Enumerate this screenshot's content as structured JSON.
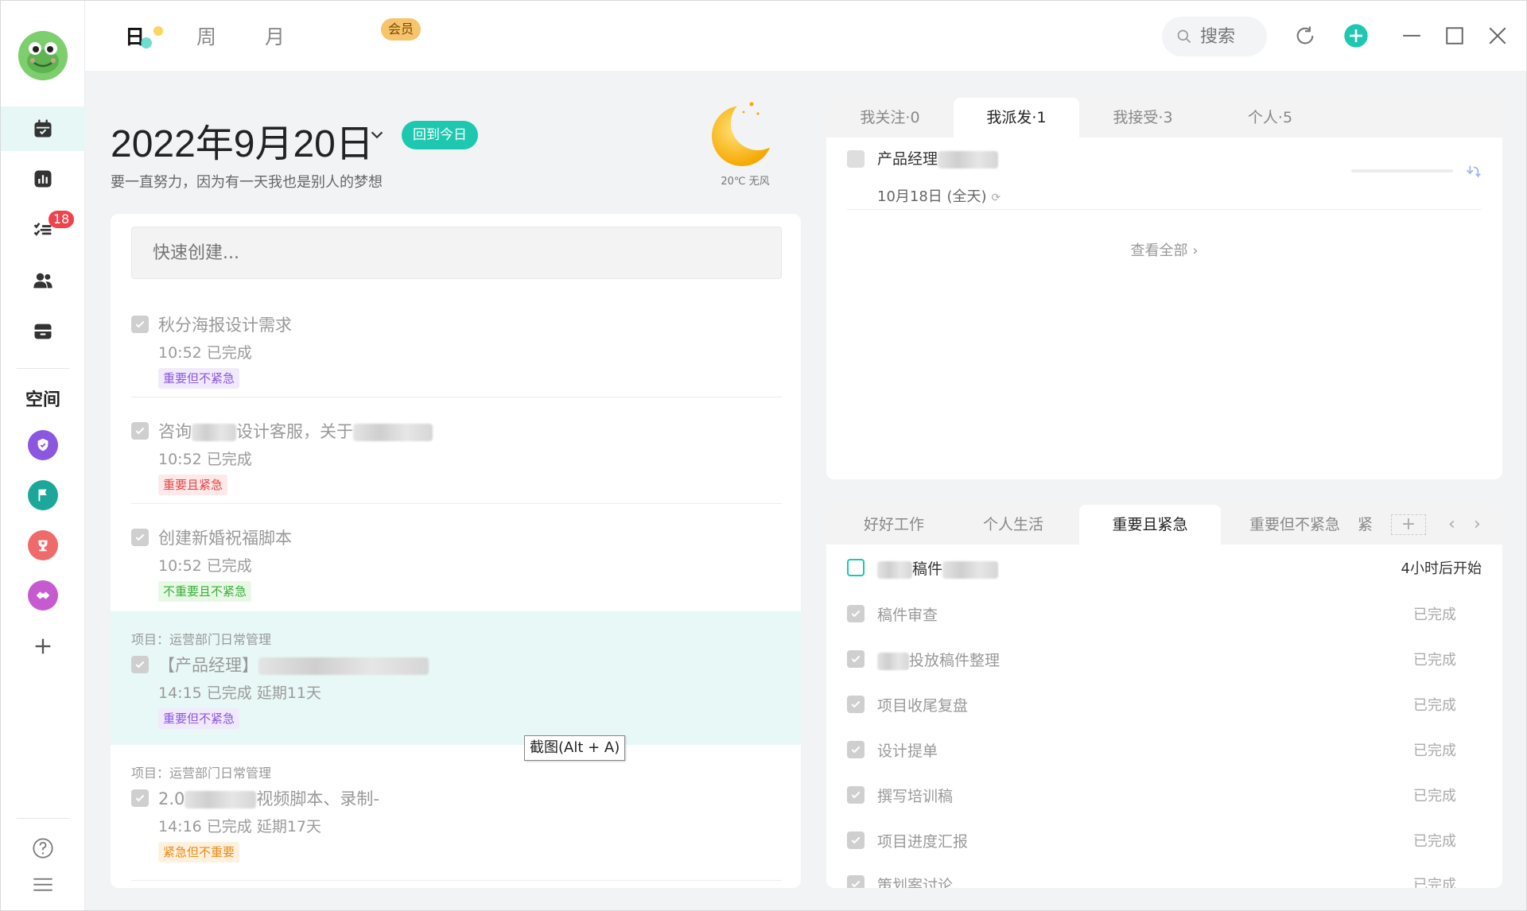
{
  "sidebar": {
    "badge_count": "18",
    "space_label": "空间"
  },
  "topbar": {
    "tabs": [
      {
        "label": "日",
        "active": true
      },
      {
        "label": "周"
      },
      {
        "label": "月"
      }
    ],
    "vip_label": "会员",
    "search_placeholder": "搜索"
  },
  "header": {
    "date": "2022年9月20日",
    "today_button": "回到今日",
    "motto": "要一直努力，因为有一天我也是别人的梦想",
    "weather": "20℃ 无风"
  },
  "tasks": {
    "quick_create_placeholder": "快速创建...",
    "items": [
      {
        "project": "",
        "title": "秋分海报设计需求",
        "meta": "10:52 已完成",
        "tag": "重要但不紧急",
        "tag_color": "purple"
      },
      {
        "project": "",
        "title_a": "咨询",
        "title_b": "设计客服，关于",
        "meta": "10:52 已完成",
        "tag": "重要且紧急",
        "tag_color": "red"
      },
      {
        "project": "",
        "title": "创建新婚祝福脚本",
        "meta": "10:52 已完成",
        "tag": "不重要且不紧急",
        "tag_color": "green"
      },
      {
        "project": "项目：运营部门日常管理",
        "title": "【产品经理】",
        "meta": "14:15 已完成 延期11天",
        "tag": "重要但不紧急",
        "tag_color": "purple"
      },
      {
        "project": "项目：运营部门日常管理",
        "title_a": "2.0",
        "title_b": "视频脚本、录制-",
        "meta": "14:16 已完成 延期17天",
        "tag": "紧急但不重要",
        "tag_color": "orange"
      }
    ],
    "tooltip": "截图(Alt + A)"
  },
  "top_right": {
    "tabs": [
      {
        "label": "我关注·0"
      },
      {
        "label": "我派发·1",
        "active": true
      },
      {
        "label": "我接受·3"
      },
      {
        "label": "个人·5"
      }
    ],
    "item_title": "产品经理",
    "item_date": "10月18日 (全天)",
    "view_all": "查看全部"
  },
  "bottom_right": {
    "tabs": [
      {
        "label": "好好工作"
      },
      {
        "label": "个人生活"
      },
      {
        "label": "重要且紧急",
        "active": true
      },
      {
        "label": "重要但不紧急"
      },
      {
        "label": "紧急"
      }
    ],
    "rows": [
      {
        "name": "稿件",
        "state": "4小时后开始",
        "done": false
      },
      {
        "name": "稿件审查",
        "state": "已完成",
        "done": true
      },
      {
        "name": "投放稿件整理",
        "state": "已完成",
        "done": true
      },
      {
        "name": "项目收尾复盘",
        "state": "已完成",
        "done": true
      },
      {
        "name": "设计提单",
        "state": "已完成",
        "done": true
      },
      {
        "name": "撰写培训稿",
        "state": "已完成",
        "done": true
      },
      {
        "name": "项目进度汇报",
        "state": "已完成",
        "done": true
      },
      {
        "name": "策划案讨论",
        "state": "已完成",
        "done": true
      }
    ]
  },
  "colors": {
    "accent": "#1ec8b0",
    "badge": "#f0424b",
    "vip": "#f6c46b"
  }
}
